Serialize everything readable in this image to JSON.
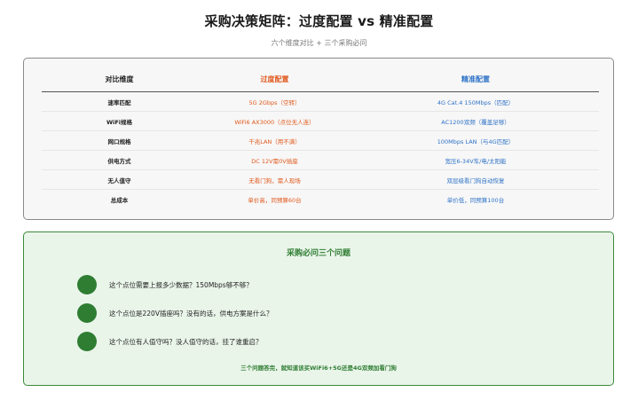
{
  "page": {
    "title": "采购决策矩阵：过度配置 vs 精准配置",
    "subtitle": "六个维度对比 + 三个采购必问"
  },
  "comparison": {
    "headers": [
      "对比维度",
      "过度配置",
      "精准配置"
    ],
    "rows": [
      [
        "速率匹配",
        "5G 2Gbps（空转）",
        "4G Cat.4 150Mbps（匹配）"
      ],
      [
        "WiFi规格",
        "WiFi6 AX3000（点位无人连）",
        "AC1200双频（覆盖足够）"
      ],
      [
        "网口规格",
        "千兆LAN（用不满）",
        "100Mbps LAN（与4G匹配）"
      ],
      [
        "供电方式",
        "DC 12V需0V插座",
        "宽压6-34V车/电/太阳能"
      ],
      [
        "无人值守",
        "无看门狗，需人现场",
        "双层级看门狗自动恢复"
      ],
      [
        "总成本",
        "单价高，同预算60台",
        "单价低，同预算100台"
      ]
    ],
    "colors": {
      "over": "#e0591c",
      "precise": "#2f73c7"
    }
  },
  "questions": {
    "title": "采购必问三个问题",
    "items": [
      "这个点位需要上报多少数据？150Mbps够不够？",
      "这个点位是220V插座吗？没有的话，供电方案是什么？",
      "这个点位有人值守吗？没人值守的话，挂了谁重启？"
    ],
    "footer": "三个问题答完，就知道该买WiFi6+5G还是4G双频加看门狗",
    "accent": "#2e7d32"
  }
}
